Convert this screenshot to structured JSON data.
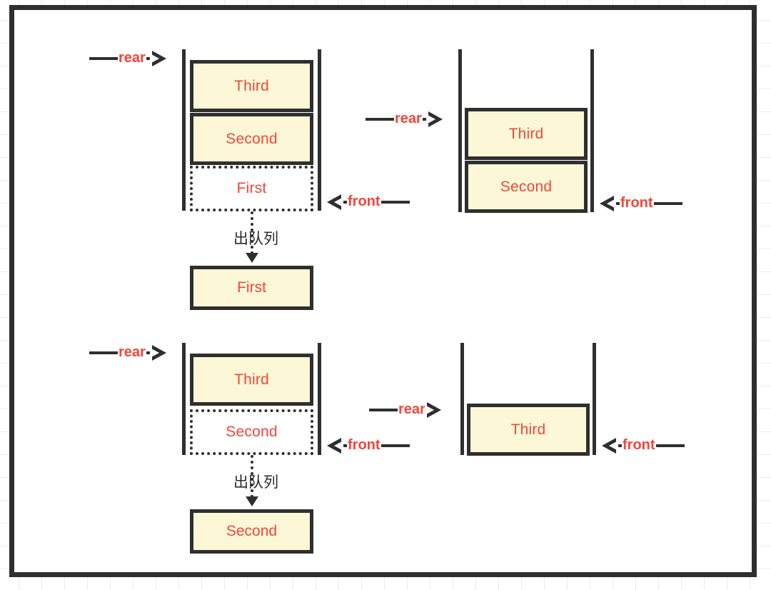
{
  "diagram": {
    "title": "Queue dequeue operation diagram",
    "colors": {
      "cell_fill": "#fcf8d7",
      "stroke": "#2f2f2f",
      "text_red": "#f4453a",
      "label_dark": "#2b2b2b",
      "grid": "#ececec",
      "background": "#ffffff"
    },
    "labels": {
      "rear": "rear",
      "front": "front",
      "dequeue": "出队列"
    },
    "panels": [
      {
        "id": "top-left",
        "role": "before-first-dequeue",
        "cells": [
          {
            "text": "Third",
            "state": "solid"
          },
          {
            "text": "Second",
            "state": "solid"
          },
          {
            "text": "First",
            "state": "ghost"
          }
        ],
        "rear_label": "rear",
        "front_label": "front",
        "dequeue_label": "出队列",
        "popped": "First"
      },
      {
        "id": "top-right",
        "role": "after-first-dequeue",
        "cells": [
          {
            "text": "Third",
            "state": "solid"
          },
          {
            "text": "Second",
            "state": "solid"
          }
        ],
        "rear_label": "rear",
        "front_label": "front"
      },
      {
        "id": "bottom-left",
        "role": "before-second-dequeue",
        "cells": [
          {
            "text": "Third",
            "state": "solid"
          },
          {
            "text": "Second",
            "state": "ghost"
          }
        ],
        "rear_label": "rear",
        "front_label": "front",
        "dequeue_label": "出队列",
        "popped": "Second"
      },
      {
        "id": "bottom-right",
        "role": "after-second-dequeue",
        "cells": [
          {
            "text": "Third",
            "state": "solid"
          }
        ],
        "rear_label": "rear",
        "front_label": "front"
      }
    ]
  }
}
